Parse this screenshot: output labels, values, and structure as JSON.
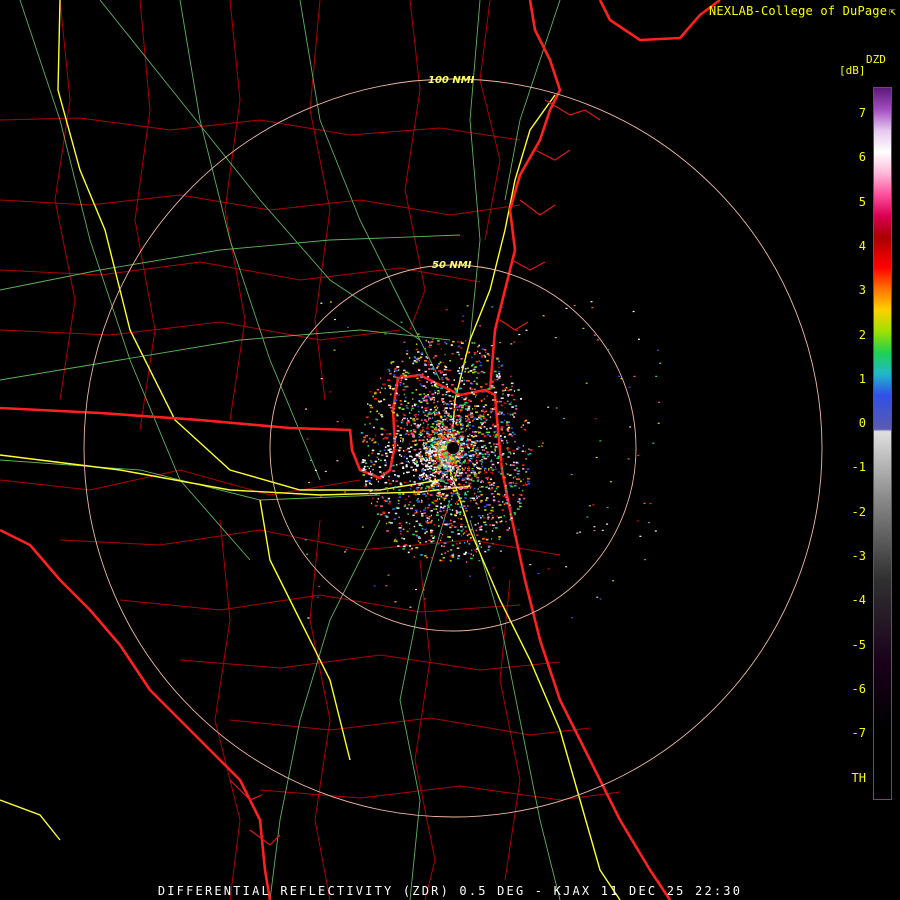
{
  "credit": {
    "text": "NEXLAB-College of DuPage",
    "icon": "external-link-icon"
  },
  "colorbar": {
    "product": "DZD",
    "units": "[dB]",
    "ticks": [
      "7",
      "6",
      "5",
      "4",
      "3",
      "2",
      "1",
      "0",
      "-1",
      "-2",
      "-3",
      "-4",
      "-5",
      "-6",
      "-7",
      "TH"
    ],
    "scale": [
      {
        "v": 7.5,
        "color": "#5a1a7a"
      },
      {
        "v": 7.0,
        "color": "#a34ec0"
      },
      {
        "v": 6.5,
        "color": "#e6c8f0"
      },
      {
        "v": 6.0,
        "color": "#ffffff"
      },
      {
        "v": 5.5,
        "color": "#ffb8d8"
      },
      {
        "v": 5.0,
        "color": "#ff4f9e"
      },
      {
        "v": 4.5,
        "color": "#d80052"
      },
      {
        "v": 4.0,
        "color": "#aa0000"
      },
      {
        "v": 3.3,
        "color": "#ff0000"
      },
      {
        "v": 2.8,
        "color": "#ff7000"
      },
      {
        "v": 2.3,
        "color": "#ffd000"
      },
      {
        "v": 1.8,
        "color": "#a0e000"
      },
      {
        "v": 1.3,
        "color": "#20d050"
      },
      {
        "v": 0.8,
        "color": "#20b8c8"
      },
      {
        "v": 0.3,
        "color": "#3050e8"
      },
      {
        "v": -0.5,
        "color": "#5a5ab0"
      },
      {
        "v": -0.55,
        "color": "#e0e0e0"
      },
      {
        "v": -2.0,
        "color": "#909090"
      },
      {
        "v": -4.0,
        "color": "#303030"
      },
      {
        "v": -6.0,
        "color": "#1a001a"
      },
      {
        "v": -7.5,
        "color": "#000000"
      }
    ]
  },
  "range_rings": [
    "100 NMI",
    "50 NMI"
  ],
  "footer": "DIFFERENTIAL REFLECTIVITY (ZDR) 0.5 DEG - KJAX 11 DEC 25 22:30",
  "colors": {
    "text": "#ffff00",
    "state_border": "#ff2020",
    "county": "#b00000",
    "highway": "#ffff40",
    "road": "#80e080",
    "ring": "#f0b8a0"
  }
}
